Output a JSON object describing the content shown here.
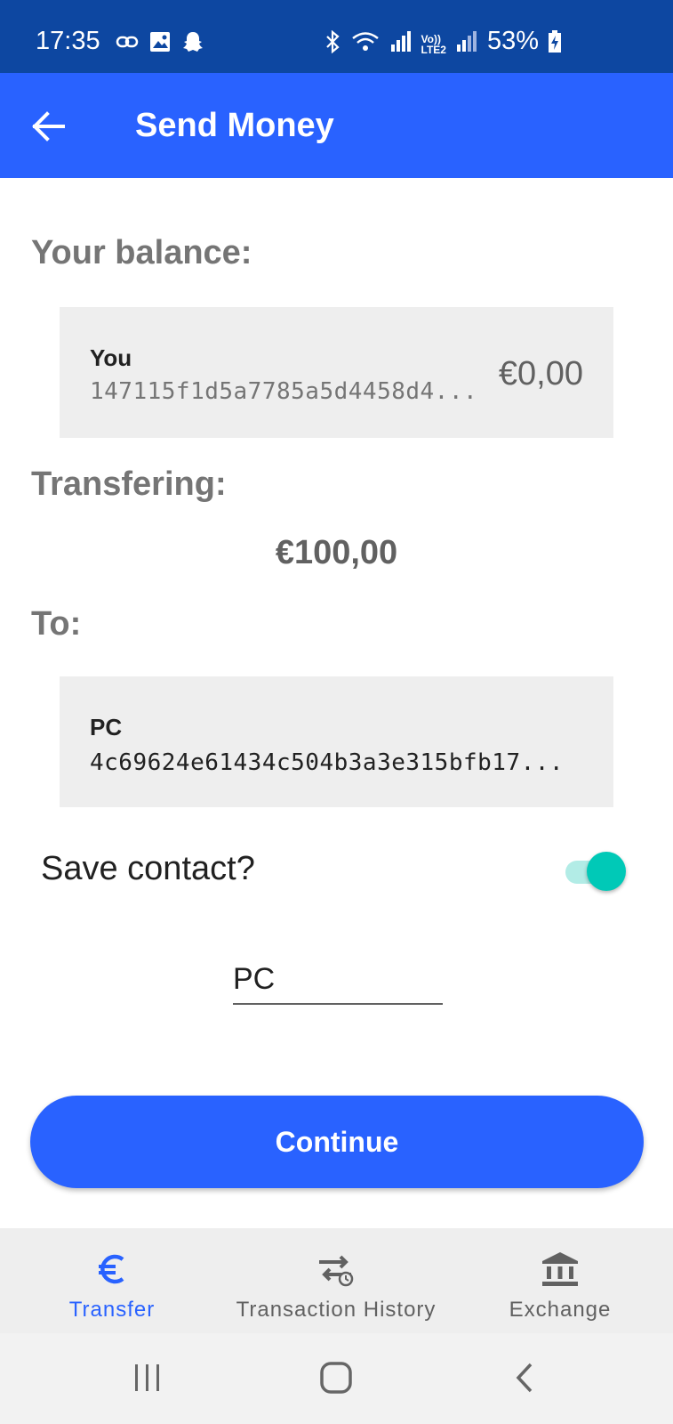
{
  "status_bar": {
    "time": "17:35",
    "battery": "53%",
    "background": "#0d47a1",
    "left_icons": [
      "link-icon",
      "image-icon",
      "snapchat-icon"
    ],
    "right_icons": [
      "bluetooth-icon",
      "wifi-icon",
      "signal-icon",
      "volte-icon",
      "signal-icon",
      "battery-charging-icon"
    ],
    "network_label": "LTE2"
  },
  "app_bar": {
    "title": "Send Money",
    "back_icon": "arrow-back-icon",
    "background": "#2962ff"
  },
  "balance": {
    "label": "Your balance:",
    "name": "You",
    "address": "147115f1d5a7785a5d4458d4...",
    "amount": "€0,00"
  },
  "transfer": {
    "label": "Transfering:",
    "amount": "€100,00"
  },
  "recipient": {
    "label": "To:",
    "name": "PC",
    "address": "4c69624e61434c504b3a3e315bfb17..."
  },
  "save_contact": {
    "label": "Save contact?",
    "enabled": true,
    "accent": "#00c9b7"
  },
  "contact_name_input": {
    "value": "PC"
  },
  "continue_button": {
    "label": "Continue"
  },
  "bottom_nav": {
    "items": [
      {
        "label": "Transfer",
        "icon": "euro-icon",
        "active": true
      },
      {
        "label": "Transaction History",
        "icon": "transaction-history-icon",
        "active": false
      },
      {
        "label": "Exchange",
        "icon": "bank-icon",
        "active": false
      }
    ],
    "active_color": "#2962ff"
  },
  "system_nav": {
    "buttons": [
      "recent-apps-icon",
      "home-icon",
      "back-icon"
    ]
  }
}
